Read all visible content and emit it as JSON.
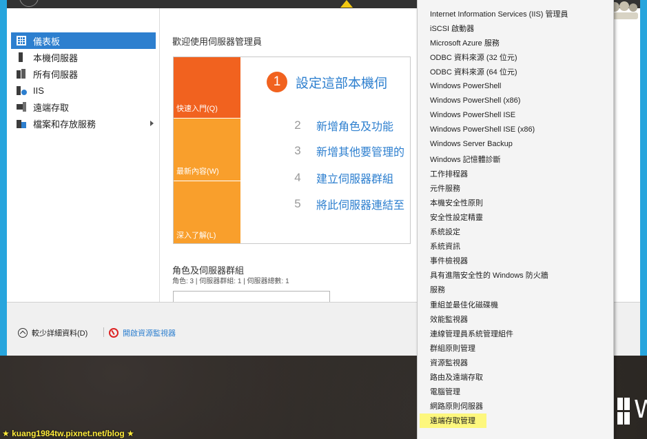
{
  "sidebar": {
    "items": [
      {
        "label": "儀表板",
        "icon": "dashboard-icon",
        "active": true
      },
      {
        "label": "本機伺服器",
        "icon": "local-server-icon"
      },
      {
        "label": "所有伺服器",
        "icon": "all-servers-icon"
      },
      {
        "label": "IIS",
        "icon": "iis-icon"
      },
      {
        "label": "遠端存取",
        "icon": "remote-access-icon"
      },
      {
        "label": "檔案和存放服務",
        "icon": "file-storage-icon",
        "has_submenu": true
      }
    ]
  },
  "main": {
    "welcome_title": "歡迎使用伺服器管理員",
    "tiles": {
      "quick_start": "快速入門(Q)",
      "whats_new": "最新內容(W)",
      "learn_more": "深入了解(L)"
    },
    "steps": [
      {
        "number": "1",
        "text": "設定這部本機伺"
      },
      {
        "number": "2",
        "text": "新增角色及功能"
      },
      {
        "number": "3",
        "text": "新增其他要管理的"
      },
      {
        "number": "4",
        "text": "建立伺服器群組"
      },
      {
        "number": "5",
        "text": "將此伺服器連結至"
      }
    ],
    "roles_title": "角色及伺服器群組",
    "roles_subtitle": "角色: 3 | 伺服器群組: 1 | 伺服器總數: 1"
  },
  "bottom_bar": {
    "less_detail": "較少詳細資料(D)",
    "open_monitor": "開啟資源監視器"
  },
  "tools_menu": {
    "items": [
      "Internet Information Services (IIS) 管理員",
      "iSCSI 啟動器",
      "Microsoft Azure 服務",
      "ODBC 資料來源 (32 位元)",
      "ODBC 資料來源 (64 位元)",
      "Windows PowerShell",
      "Windows PowerShell (x86)",
      "Windows PowerShell ISE",
      "Windows PowerShell ISE (x86)",
      "Windows Server Backup",
      "Windows 記憶體診斷",
      "工作排程器",
      "元件服務",
      "本機安全性原則",
      "安全性設定精靈",
      "系統設定",
      "系統資訊",
      "事件檢視器",
      "具有進階安全性的 Windows 防火牆",
      "服務",
      "重組並最佳化磁碟機",
      "效能監視器",
      "連線管理員系統管理組件",
      "群組原則管理",
      "資源監視器",
      "路由及遠端存取",
      "電腦管理",
      "網路原則伺服器",
      "遠端存取管理"
    ],
    "highlighted": "遠端存取管理"
  },
  "desktop": {
    "windows_text": "W",
    "watermark": "★ kuang1984tw.pixnet.net/blog ★"
  },
  "colors": {
    "accent_blue": "#2d7fcf",
    "window_border": "#27a5dd",
    "tile_orange": "#f1621f",
    "tile_amber": "#f99f2c",
    "highlight_yellow": "#fdf77d"
  }
}
